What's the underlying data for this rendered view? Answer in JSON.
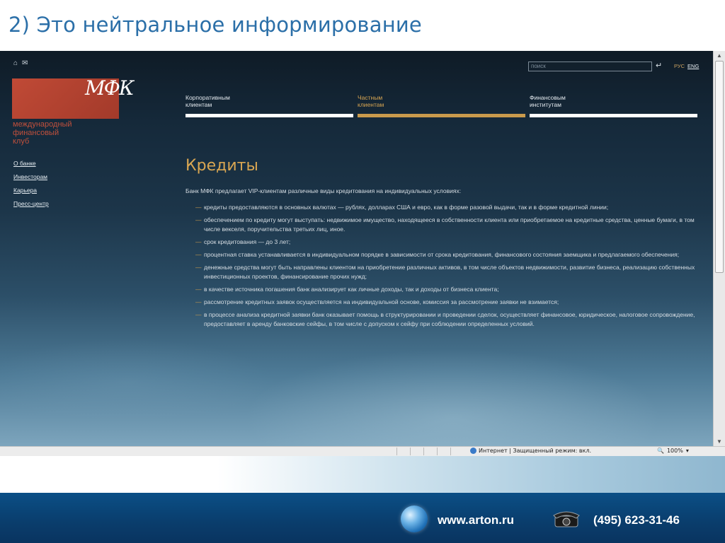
{
  "slide_title": "2) Это нейтральное информирование",
  "site": {
    "search_placeholder": "поиск",
    "lang": {
      "ru": "РУС",
      "en": "ENG"
    },
    "logo_text": "международный\nфинансовый\nклуб",
    "left_nav": [
      "О банке",
      "Инвесторам",
      "Карьера",
      "Пресс-центр"
    ],
    "tabs": [
      {
        "label": "Корпоративным\nклиентам",
        "active": false
      },
      {
        "label": "Частным\nклиентам",
        "active": true
      },
      {
        "label": "Финансовым\nинститутам",
        "active": false
      }
    ],
    "heading": "Кредиты",
    "intro": "Банк МФК предлагает VIP-клиентам различные виды кредитования на индивидуальных условиях:",
    "items": [
      "кредиты предоставляются в основных валютах — рублях, долларах США и евро, как в форме разовой выдачи, так и в форме кредитной линии;",
      "обеспечением по кредиту могут выступать: недвижимое имущество, находящееся в собственности клиента или приобретаемое на кредитные средства, ценные бумаги, в том числе векселя, поручительства третьих лиц, иное.",
      "срок кредитования — до 3 лет;",
      "процентная ставка устанавливается в индивидуальном порядке в зависимости от срока кредитования, финансового состояния заемщика и предлагаемого обеспечения;",
      "денежные средства могут быть направлены клиентом на приобретение различных активов, в том числе объектов недвижимости, развитие бизнеса, реализацию собственных инвестиционных проектов, финансирование прочих нужд;",
      "в качестве источника погашения банк анализирует как личные доходы, так и доходы от бизнеса клиента;",
      "рассмотрение кредитных заявок осуществляется на индивидуальной основе, комиссия за рассмотрение заявки не взимается;",
      "в процессе анализа кредитной заявки банк оказывает помощь в структурировании и проведении сделок, осуществляет финансовое, юридическое, налоговое сопровождение, предоставляет в аренду банковские сейфы, в том числе с допуском к сейфу при соблюдении определенных условий."
    ]
  },
  "browser_status": {
    "zone": "Интернет | Защищенный режим: вкл.",
    "zoom": "100%"
  },
  "footer": {
    "url": "www.arton.ru",
    "phone": "(495) 623-31-46"
  },
  "colors": {
    "accent": "#d9a652",
    "title": "#2b6fa8",
    "footer": "#0a3d6c"
  }
}
